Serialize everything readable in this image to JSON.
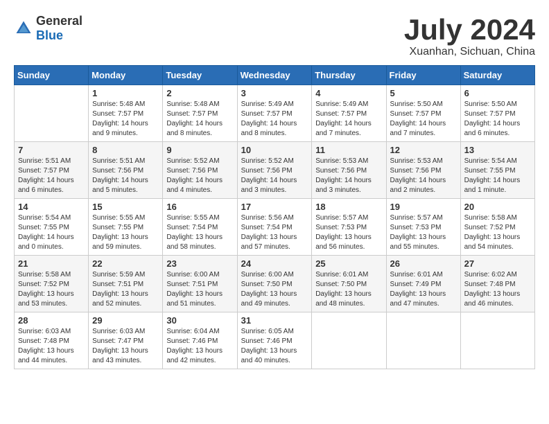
{
  "header": {
    "logo_general": "General",
    "logo_blue": "Blue",
    "month_title": "July 2024",
    "location": "Xuanhan, Sichuan, China"
  },
  "weekdays": [
    "Sunday",
    "Monday",
    "Tuesday",
    "Wednesday",
    "Thursday",
    "Friday",
    "Saturday"
  ],
  "weeks": [
    [
      {
        "day": "",
        "info": ""
      },
      {
        "day": "1",
        "info": "Sunrise: 5:48 AM\nSunset: 7:57 PM\nDaylight: 14 hours\nand 9 minutes."
      },
      {
        "day": "2",
        "info": "Sunrise: 5:48 AM\nSunset: 7:57 PM\nDaylight: 14 hours\nand 8 minutes."
      },
      {
        "day": "3",
        "info": "Sunrise: 5:49 AM\nSunset: 7:57 PM\nDaylight: 14 hours\nand 8 minutes."
      },
      {
        "day": "4",
        "info": "Sunrise: 5:49 AM\nSunset: 7:57 PM\nDaylight: 14 hours\nand 7 minutes."
      },
      {
        "day": "5",
        "info": "Sunrise: 5:50 AM\nSunset: 7:57 PM\nDaylight: 14 hours\nand 7 minutes."
      },
      {
        "day": "6",
        "info": "Sunrise: 5:50 AM\nSunset: 7:57 PM\nDaylight: 14 hours\nand 6 minutes."
      }
    ],
    [
      {
        "day": "7",
        "info": "Sunrise: 5:51 AM\nSunset: 7:57 PM\nDaylight: 14 hours\nand 6 minutes."
      },
      {
        "day": "8",
        "info": "Sunrise: 5:51 AM\nSunset: 7:56 PM\nDaylight: 14 hours\nand 5 minutes."
      },
      {
        "day": "9",
        "info": "Sunrise: 5:52 AM\nSunset: 7:56 PM\nDaylight: 14 hours\nand 4 minutes."
      },
      {
        "day": "10",
        "info": "Sunrise: 5:52 AM\nSunset: 7:56 PM\nDaylight: 14 hours\nand 3 minutes."
      },
      {
        "day": "11",
        "info": "Sunrise: 5:53 AM\nSunset: 7:56 PM\nDaylight: 14 hours\nand 3 minutes."
      },
      {
        "day": "12",
        "info": "Sunrise: 5:53 AM\nSunset: 7:56 PM\nDaylight: 14 hours\nand 2 minutes."
      },
      {
        "day": "13",
        "info": "Sunrise: 5:54 AM\nSunset: 7:55 PM\nDaylight: 14 hours\nand 1 minute."
      }
    ],
    [
      {
        "day": "14",
        "info": "Sunrise: 5:54 AM\nSunset: 7:55 PM\nDaylight: 14 hours\nand 0 minutes."
      },
      {
        "day": "15",
        "info": "Sunrise: 5:55 AM\nSunset: 7:55 PM\nDaylight: 13 hours\nand 59 minutes."
      },
      {
        "day": "16",
        "info": "Sunrise: 5:55 AM\nSunset: 7:54 PM\nDaylight: 13 hours\nand 58 minutes."
      },
      {
        "day": "17",
        "info": "Sunrise: 5:56 AM\nSunset: 7:54 PM\nDaylight: 13 hours\nand 57 minutes."
      },
      {
        "day": "18",
        "info": "Sunrise: 5:57 AM\nSunset: 7:53 PM\nDaylight: 13 hours\nand 56 minutes."
      },
      {
        "day": "19",
        "info": "Sunrise: 5:57 AM\nSunset: 7:53 PM\nDaylight: 13 hours\nand 55 minutes."
      },
      {
        "day": "20",
        "info": "Sunrise: 5:58 AM\nSunset: 7:52 PM\nDaylight: 13 hours\nand 54 minutes."
      }
    ],
    [
      {
        "day": "21",
        "info": "Sunrise: 5:58 AM\nSunset: 7:52 PM\nDaylight: 13 hours\nand 53 minutes."
      },
      {
        "day": "22",
        "info": "Sunrise: 5:59 AM\nSunset: 7:51 PM\nDaylight: 13 hours\nand 52 minutes."
      },
      {
        "day": "23",
        "info": "Sunrise: 6:00 AM\nSunset: 7:51 PM\nDaylight: 13 hours\nand 51 minutes."
      },
      {
        "day": "24",
        "info": "Sunrise: 6:00 AM\nSunset: 7:50 PM\nDaylight: 13 hours\nand 49 minutes."
      },
      {
        "day": "25",
        "info": "Sunrise: 6:01 AM\nSunset: 7:50 PM\nDaylight: 13 hours\nand 48 minutes."
      },
      {
        "day": "26",
        "info": "Sunrise: 6:01 AM\nSunset: 7:49 PM\nDaylight: 13 hours\nand 47 minutes."
      },
      {
        "day": "27",
        "info": "Sunrise: 6:02 AM\nSunset: 7:48 PM\nDaylight: 13 hours\nand 46 minutes."
      }
    ],
    [
      {
        "day": "28",
        "info": "Sunrise: 6:03 AM\nSunset: 7:48 PM\nDaylight: 13 hours\nand 44 minutes."
      },
      {
        "day": "29",
        "info": "Sunrise: 6:03 AM\nSunset: 7:47 PM\nDaylight: 13 hours\nand 43 minutes."
      },
      {
        "day": "30",
        "info": "Sunrise: 6:04 AM\nSunset: 7:46 PM\nDaylight: 13 hours\nand 42 minutes."
      },
      {
        "day": "31",
        "info": "Sunrise: 6:05 AM\nSunset: 7:46 PM\nDaylight: 13 hours\nand 40 minutes."
      },
      {
        "day": "",
        "info": ""
      },
      {
        "day": "",
        "info": ""
      },
      {
        "day": "",
        "info": ""
      }
    ]
  ]
}
